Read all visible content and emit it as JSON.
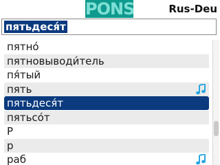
{
  "header": {
    "logo_text": "PONS",
    "language_pair": "Rus-Deu"
  },
  "search": {
    "value": "пятьдеся́т"
  },
  "list": {
    "items": [
      {
        "label": "пятно́",
        "audio": false,
        "selected": false
      },
      {
        "label": "пятновыводи́тель",
        "audio": false,
        "selected": false
      },
      {
        "label": "пя́тый",
        "audio": false,
        "selected": false
      },
      {
        "label": "пять",
        "audio": true,
        "selected": false
      },
      {
        "label": "пятьдеся́т",
        "audio": false,
        "selected": true
      },
      {
        "label": "пятьсо́т",
        "audio": false,
        "selected": false
      },
      {
        "label": "Р",
        "audio": false,
        "selected": false
      },
      {
        "label": "р",
        "audio": false,
        "selected": false
      },
      {
        "label": "раб",
        "audio": true,
        "selected": false
      }
    ]
  },
  "scrollbar": {
    "position": 0.74,
    "visible_fraction": 0.12
  },
  "colors": {
    "selection": "#0b3a7e",
    "audio_icon": "#2aa7e0",
    "logo_bg": "#0f9a8e"
  }
}
